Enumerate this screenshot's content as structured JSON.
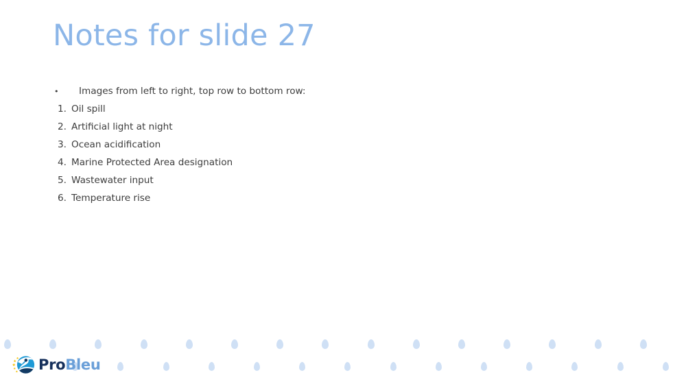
{
  "slide": {
    "title": "Notes for slide 27",
    "background_color": "#ffffff",
    "title_color": "#8cb6e8",
    "body_text_color": "#3c3c3c"
  },
  "body": {
    "bullet": {
      "marker": "•",
      "text": "Images from left to right, top row to bottom row:"
    },
    "numbered_items": [
      {
        "marker": "1.",
        "text": "Oil spill"
      },
      {
        "marker": "2.",
        "text": "Artificial light at night"
      },
      {
        "marker": "3.",
        "text": "Ocean acidification"
      },
      {
        "marker": "4.",
        "text": "Marine Protected Area designation"
      },
      {
        "marker": "5.",
        "text": "Wastewater input"
      },
      {
        "marker": "6.",
        "text": "Temperature rise"
      }
    ]
  },
  "footer": {
    "logo": {
      "icon_name": "probleu-globe-icon",
      "word_primary": "Pro",
      "word_secondary": "Bleu",
      "color_primary": "#16305c",
      "color_secondary": "#6a9fd8",
      "globe_color_light": "#1f9ad6",
      "globe_color_dark": "#123a63",
      "star_color": "#f5c518"
    },
    "decoration": {
      "icon_name": "water-droplet-icon",
      "color": "#cfe0f5",
      "row_one_count": 15,
      "row_two_count": 15
    }
  }
}
